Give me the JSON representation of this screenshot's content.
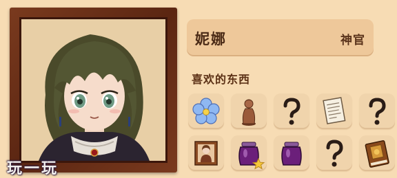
{
  "character": {
    "name": "妮娜",
    "role": "神官"
  },
  "favorites": {
    "label": "喜欢的东西",
    "items": [
      {
        "icon": "blue-flower-icon",
        "discovered": true
      },
      {
        "icon": "woman-statue-icon",
        "discovered": true
      },
      {
        "icon": "unknown-question-icon",
        "discovered": false
      },
      {
        "icon": "letter-paper-icon",
        "discovered": true
      },
      {
        "icon": "unknown-question-icon",
        "discovered": false
      },
      {
        "icon": "portrait-painting-icon",
        "discovered": true
      },
      {
        "icon": "purple-jam-jar-icon",
        "discovered": true,
        "badge": "star-icon"
      },
      {
        "icon": "purple-jam-jar-icon",
        "discovered": true
      },
      {
        "icon": "unknown-question-icon",
        "discovered": false
      },
      {
        "icon": "brown-book-icon",
        "discovered": true
      }
    ]
  },
  "watermark": "玩一玩",
  "colors": {
    "background": "#f7dcb4",
    "frame": "#6a2e16",
    "slot": "#f0d4ac",
    "text": "#4a2a16"
  }
}
